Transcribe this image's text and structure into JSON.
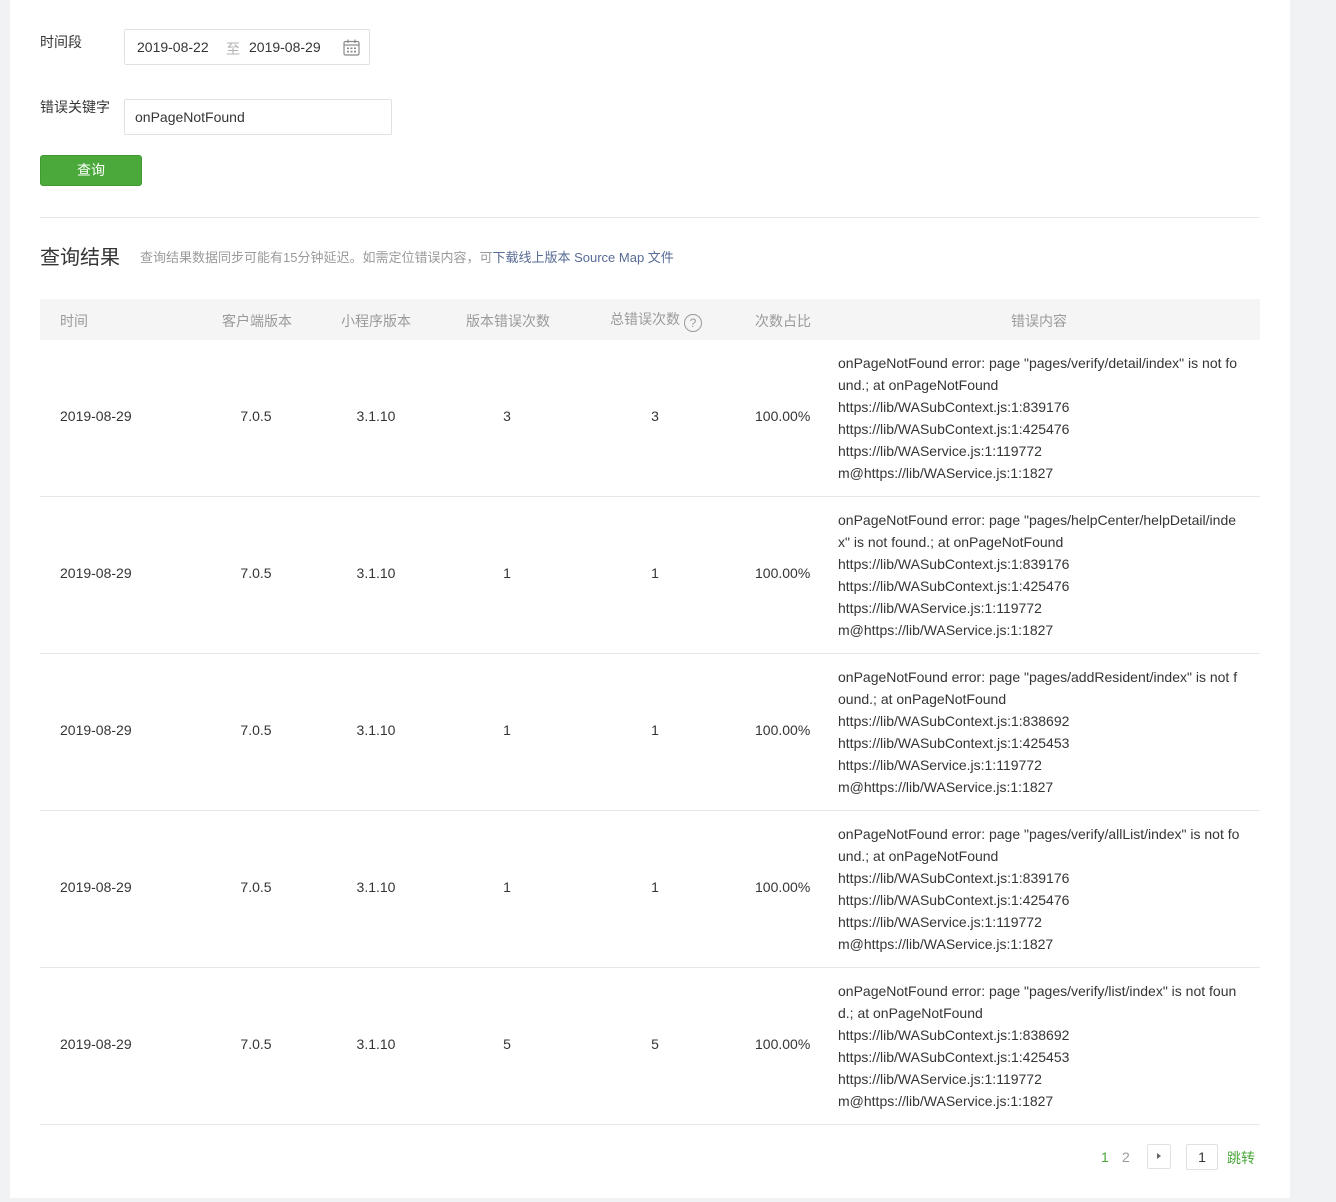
{
  "filters": {
    "time_label": "时间段",
    "date_start": "2019-08-22",
    "date_sep": "至",
    "date_end": "2019-08-29",
    "keyword_label": "错误关键字",
    "keyword_value": "onPageNotFound",
    "query_button": "查询"
  },
  "results": {
    "title": "查询结果",
    "note": "查询结果数据同步可能有15分钟延迟。如需定位错误内容，可",
    "link": "下载线上版本 Source Map 文件"
  },
  "table": {
    "headers": {
      "time": "时间",
      "client_version": "客户端版本",
      "app_version": "小程序版本",
      "version_errors": "版本错误次数",
      "total_errors": "总错误次数",
      "ratio": "次数占比",
      "content": "错误内容"
    },
    "help_glyph": "?",
    "rows": [
      {
        "time": "2019-08-29",
        "client": "7.0.5",
        "app": "3.1.10",
        "ver_err": "3",
        "total_err": "3",
        "ratio": "100.00%",
        "content": [
          "onPageNotFound error: page \"pages/verify/detail/index\" is not found.; at onPageNotFound",
          "https://lib/WASubContext.js:1:839176",
          "https://lib/WASubContext.js:1:425476",
          "https://lib/WAService.js:1:119772",
          "m@https://lib/WAService.js:1:1827"
        ]
      },
      {
        "time": "2019-08-29",
        "client": "7.0.5",
        "app": "3.1.10",
        "ver_err": "1",
        "total_err": "1",
        "ratio": "100.00%",
        "content": [
          "onPageNotFound error: page \"pages/helpCenter/helpDetail/index\" is not found.; at onPageNotFound",
          "https://lib/WASubContext.js:1:839176",
          "https://lib/WASubContext.js:1:425476",
          "https://lib/WAService.js:1:119772",
          "m@https://lib/WAService.js:1:1827"
        ]
      },
      {
        "time": "2019-08-29",
        "client": "7.0.5",
        "app": "3.1.10",
        "ver_err": "1",
        "total_err": "1",
        "ratio": "100.00%",
        "content": [
          "onPageNotFound error: page \"pages/addResident/index\" is not found.; at onPageNotFound",
          "https://lib/WASubContext.js:1:838692",
          "https://lib/WASubContext.js:1:425453",
          "https://lib/WAService.js:1:119772",
          "m@https://lib/WAService.js:1:1827"
        ]
      },
      {
        "time": "2019-08-29",
        "client": "7.0.5",
        "app": "3.1.10",
        "ver_err": "1",
        "total_err": "1",
        "ratio": "100.00%",
        "content": [
          "onPageNotFound error: page \"pages/verify/allList/index\" is not found.; at onPageNotFound",
          "https://lib/WASubContext.js:1:839176",
          "https://lib/WASubContext.js:1:425476",
          "https://lib/WAService.js:1:119772",
          "m@https://lib/WAService.js:1:1827"
        ]
      },
      {
        "time": "2019-08-29",
        "client": "7.0.5",
        "app": "3.1.10",
        "ver_err": "5",
        "total_err": "5",
        "ratio": "100.00%",
        "content": [
          "onPageNotFound error: page \"pages/verify/list/index\" is not found.; at onPageNotFound",
          "https://lib/WASubContext.js:1:838692",
          "https://lib/WASubContext.js:1:425453",
          "https://lib/WAService.js:1:119772",
          "m@https://lib/WAService.js:1:1827"
        ]
      }
    ]
  },
  "pagination": {
    "pages": [
      "1",
      "2"
    ],
    "current": "1",
    "jump_input": "1",
    "jump_label": "跳转",
    "active_color": "#4ba83b"
  },
  "icons": {
    "calendar": "calendar-icon",
    "help": "help-circle-icon",
    "next": "chevron-right-icon"
  },
  "colors": {
    "primary": "#4ba83b",
    "link": "#576b95",
    "muted": "#9a9a9a",
    "text": "#353535"
  }
}
